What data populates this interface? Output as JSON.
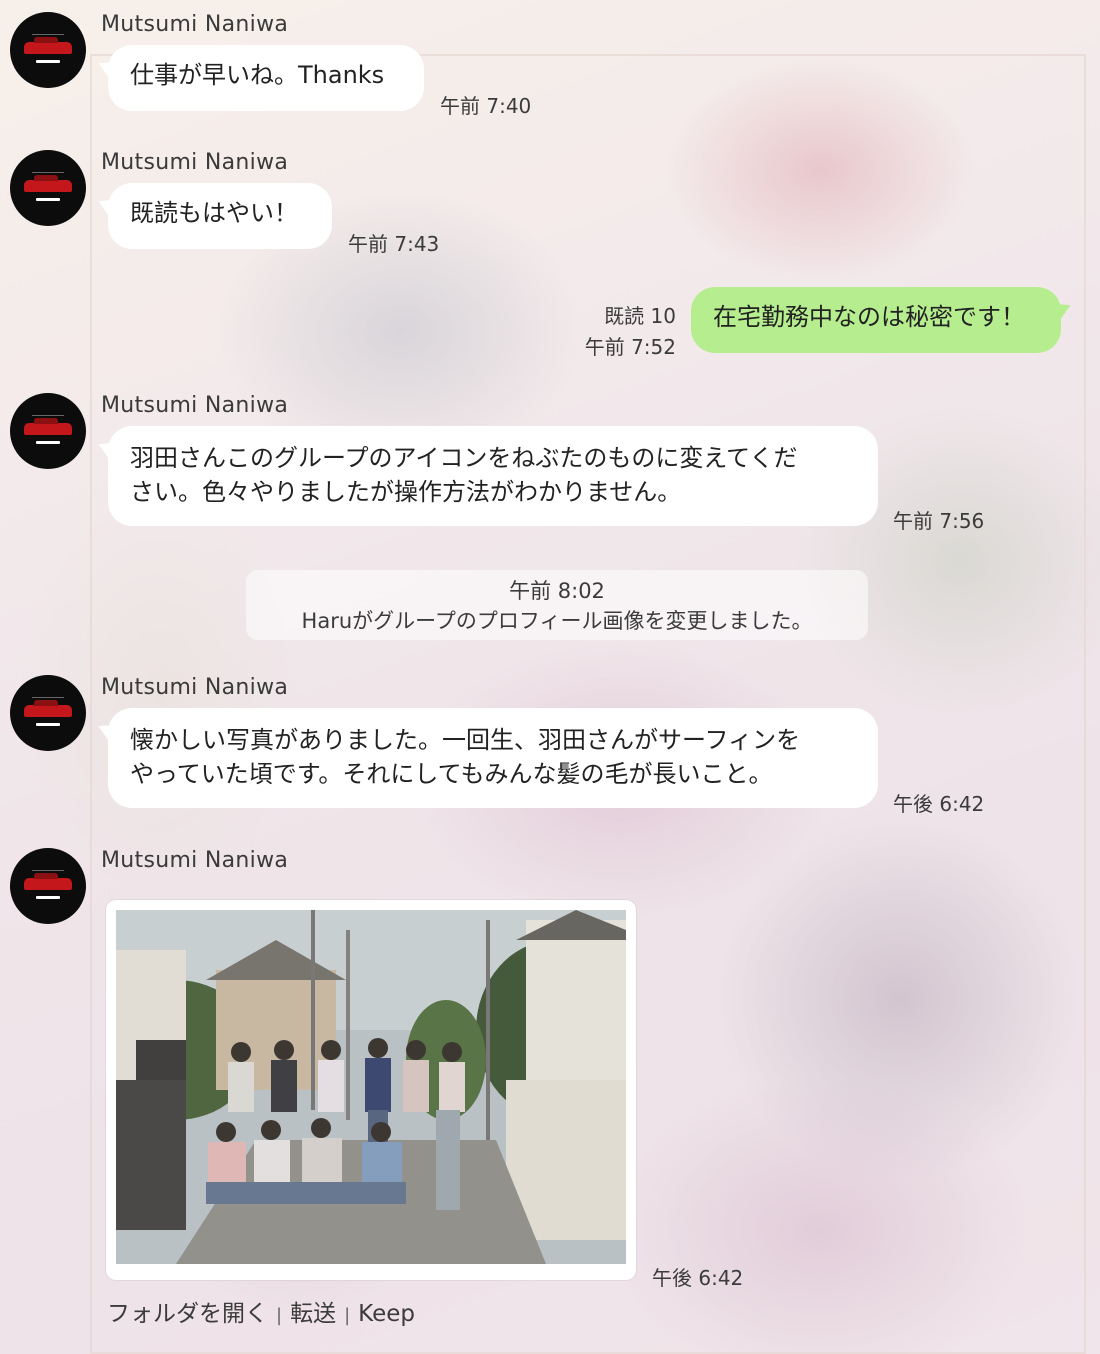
{
  "messages": [
    {
      "sender": "Mutsumi Naniwa",
      "lines": [
        "仕事が早いね。Thanks"
      ],
      "time": "午前 7:40"
    },
    {
      "sender": "Mutsumi Naniwa",
      "lines": [
        "既読もはやい！"
      ],
      "time": "午前 7:43"
    },
    {
      "read_count": "既読 10",
      "lines": [
        "在宅勤務中なのは秘密です！"
      ],
      "time": "午前 7:52"
    },
    {
      "sender": "Mutsumi Naniwa",
      "lines": [
        "羽田さんこのグループのアイコンをねぶたのものに変えてくだ",
        "さい。色々やりましたが操作方法がわかりません。"
      ],
      "time": "午前 7:56"
    },
    {
      "sender": "Mutsumi Naniwa",
      "lines": [
        "懐かしい写真がありました。一回生、羽田さんがサーフィンを",
        "やっていた頃です。それにしてもみんな髪の毛が長いこと。"
      ],
      "time": "午後 6:42"
    },
    {
      "sender": "Mutsumi Naniwa",
      "image": "group-photo",
      "time": "午後 6:42"
    }
  ],
  "system_notice": {
    "time": "午前 8:02",
    "text": "Haruがグループのプロフィール画像を変更しました。"
  },
  "image_actions": [
    "フォルダを開く",
    "転送",
    "Keep"
  ],
  "colors": {
    "incoming_bubble": "#ffffff",
    "outgoing_bubble": "#b6ee8f",
    "avatar_bg": "#0c0c0c",
    "avatar_car": "#c4171b"
  },
  "icons": {
    "avatar": "red-car-avatar-icon",
    "photo": "group-photo-image"
  }
}
